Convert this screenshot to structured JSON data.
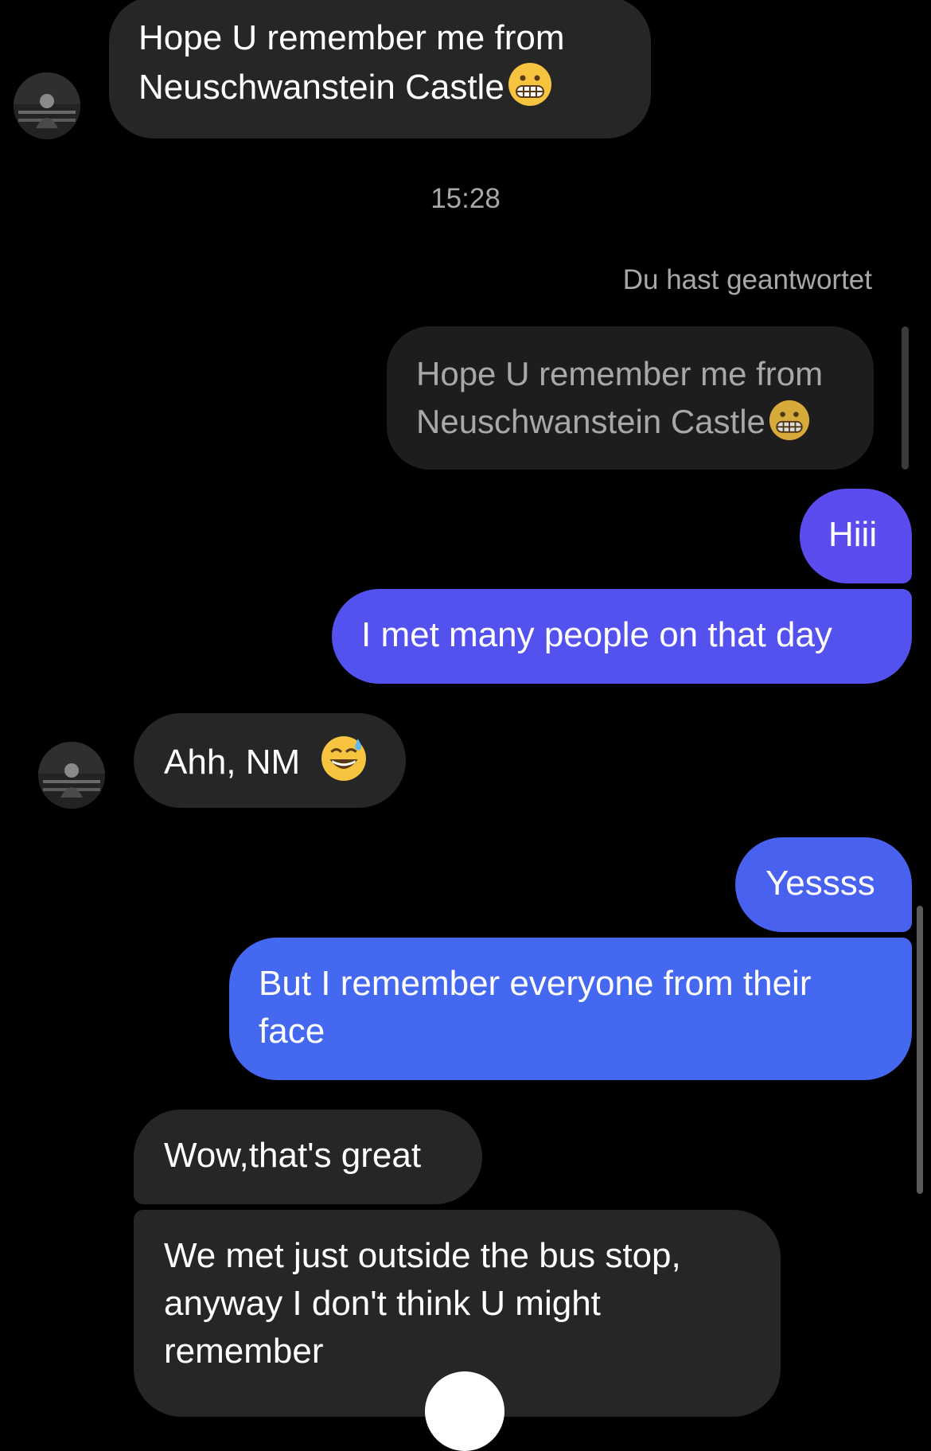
{
  "colors": {
    "background": "#000000",
    "incoming_bubble": "#262626",
    "outgoing_gradient_top": "#5a4cf0",
    "outgoing_gradient_bottom": "#3f6cf0",
    "secondary_text": "#a8a8a8"
  },
  "messages": {
    "first_incoming": {
      "line1": "Hope U remember me from",
      "line2": "Neuschwanstein Castle",
      "emoji": "grimacing-face-emoji"
    },
    "timestamp": "15:28",
    "replied_label": "Du hast geantwortet",
    "quoted": {
      "line1": "Hope U remember me from",
      "line2": "Neuschwanstein Castle",
      "emoji": "grimacing-face-emoji"
    },
    "out_hiii": "Hiii",
    "out_met_many": "I met many people on that day",
    "in_ahh": "Ahh, NM",
    "in_ahh_emoji": "grinning-sweat-emoji",
    "out_yessss": "Yessss",
    "out_remember": {
      "line1": "But I remember everyone from their",
      "line2": "face"
    },
    "in_wow": "Wow,that's great",
    "in_bus_stop": {
      "line1": "We met just outside the bus stop,",
      "line2": "anyway I don't think U might",
      "line3": "remember"
    }
  }
}
